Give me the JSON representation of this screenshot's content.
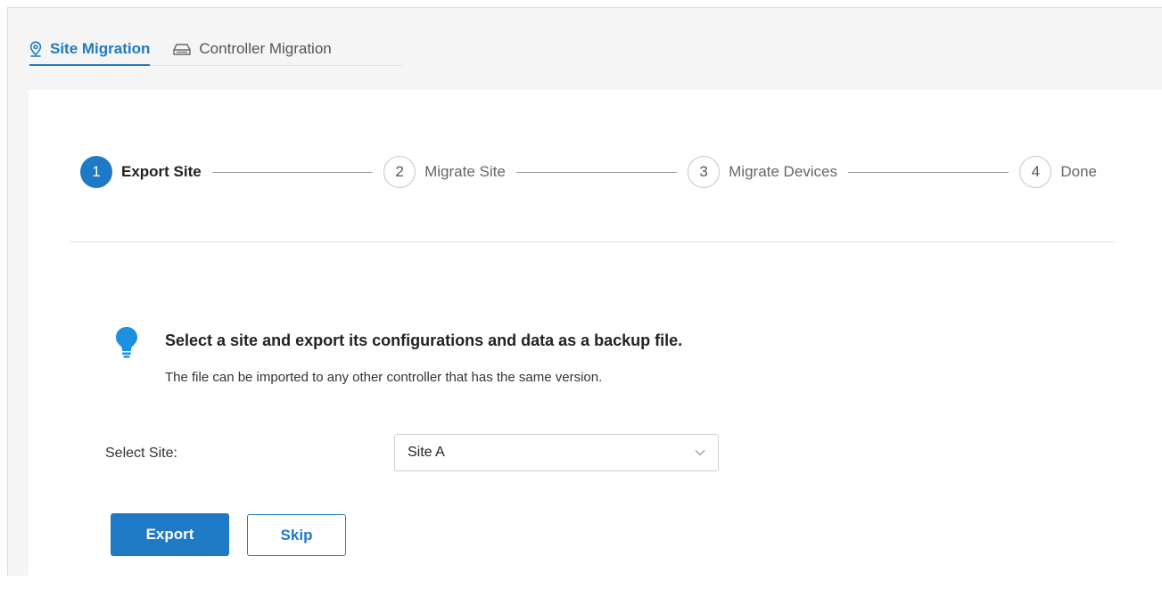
{
  "tabs": [
    {
      "label": "Site Migration",
      "icon": "location-pin-icon",
      "active": true
    },
    {
      "label": "Controller Migration",
      "icon": "controller-device-icon",
      "active": false
    }
  ],
  "steps": [
    {
      "number": "1",
      "label": "Export Site",
      "active": true
    },
    {
      "number": "2",
      "label": "Migrate Site",
      "active": false
    },
    {
      "number": "3",
      "label": "Migrate Devices",
      "active": false
    },
    {
      "number": "4",
      "label": "Done",
      "active": false
    }
  ],
  "info": {
    "title": "Select a site and export its configurations and data as a backup file.",
    "description": "The file can be imported to any other controller that has the same version."
  },
  "form": {
    "site_label": "Select Site:",
    "site_value": "Site A"
  },
  "buttons": {
    "export": "Export",
    "skip": "Skip"
  },
  "colors": {
    "accent": "#1e7ac4",
    "background": "#f5f5f5"
  }
}
